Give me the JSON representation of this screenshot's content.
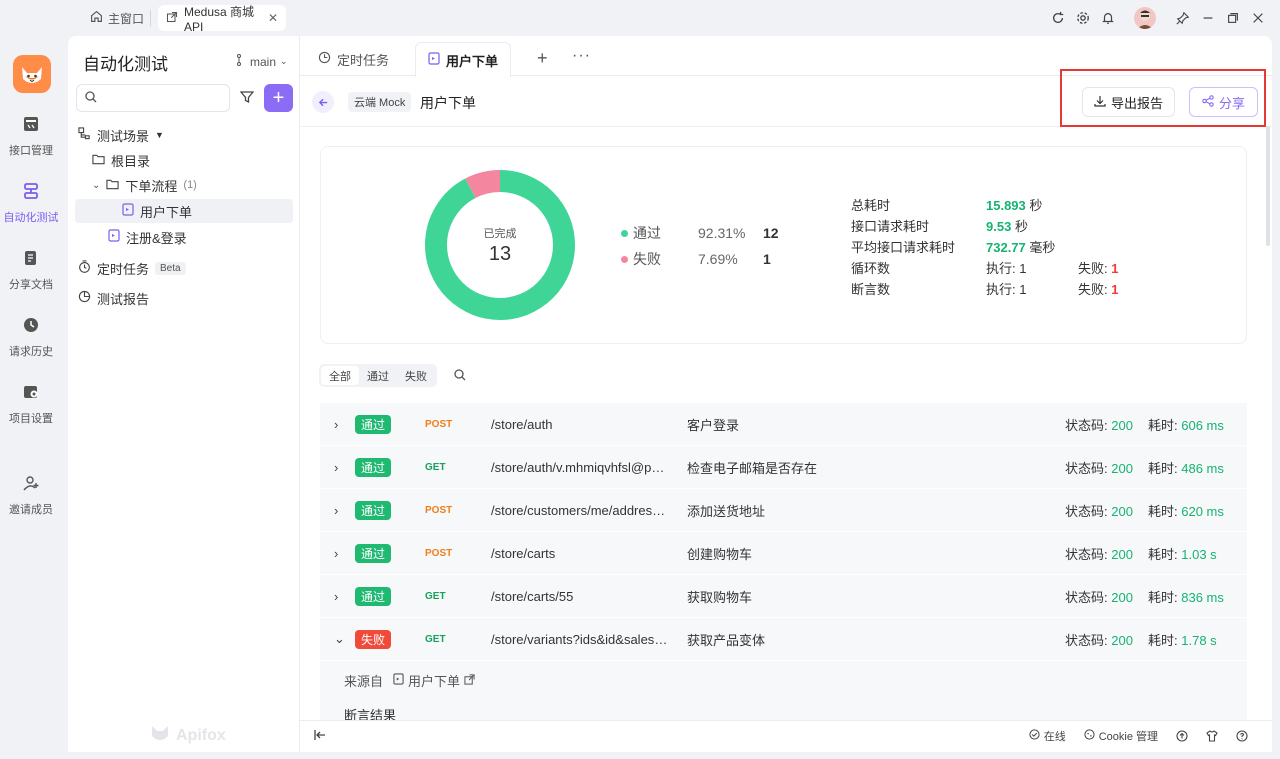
{
  "titlebar": {
    "home_tab": "主窗口",
    "project_tab": "Medusa 商城 API"
  },
  "leftnav": [
    {
      "label": "接口管理",
      "icon": "api-icon"
    },
    {
      "label": "自动化测试",
      "icon": "automation-icon"
    },
    {
      "label": "分享文档",
      "icon": "share-doc-icon"
    },
    {
      "label": "请求历史",
      "icon": "history-icon"
    },
    {
      "label": "项目设置",
      "icon": "settings-icon"
    },
    {
      "label": "邀请成员",
      "icon": "invite-icon"
    }
  ],
  "sidebar": {
    "title": "自动化测试",
    "branch": "main",
    "search_placeholder": "",
    "tree": {
      "scenes_label": "测试场景",
      "root": "根目录",
      "folder": "下单流程",
      "folder_count": "(1)",
      "active_item": "用户下单",
      "item2": "注册&登录",
      "scheduled": "定时任务",
      "beta": "Beta",
      "reports": "测试报告"
    },
    "watermark": "Apifox"
  },
  "tabs": [
    {
      "label": "定时任务"
    },
    {
      "label": "用户下单"
    }
  ],
  "header": {
    "mock_badge": "云端 Mock",
    "title": "用户下单",
    "export_label": "导出报告",
    "share_label": "分享"
  },
  "summary": {
    "center_label": "已完成",
    "total": "13",
    "pass_label": "通过",
    "pass_pct": "92.31%",
    "pass_count": "12",
    "fail_label": "失败",
    "fail_pct": "7.69%",
    "fail_count": "1",
    "pass_color": "#3ed597",
    "fail_color": "#f4879f",
    "pass_fraction": 0.9231,
    "stats": {
      "total_time_label": "总耗时",
      "total_time_value": "15.893",
      "total_time_unit": "秒",
      "req_time_label": "接口请求耗时",
      "req_time_value": "9.53",
      "req_time_unit": "秒",
      "avg_time_label": "平均接口请求耗时",
      "avg_time_value": "732.77",
      "avg_time_unit": "毫秒",
      "loops_label": "循环数",
      "loops_exec": "执行: 1",
      "loops_fail_label": "失败:",
      "loops_fail": "1",
      "asserts_label": "断言数",
      "asserts_exec": "执行: 1",
      "asserts_fail_label": "失败:",
      "asserts_fail": "1"
    }
  },
  "filters": [
    "全部",
    "通过",
    "失败"
  ],
  "results": [
    {
      "status": "通过",
      "ok": true,
      "method": "POST",
      "path": "/store/auth",
      "desc": "客户登录",
      "code_label": "状态码:",
      "code": "200",
      "time_label": "耗时:",
      "time": "606 ms"
    },
    {
      "status": "通过",
      "ok": true,
      "method": "GET",
      "path": "/store/auth/v.mhmiqvhfsl@pbl...",
      "desc": "检查电子邮箱是否存在",
      "code_label": "状态码:",
      "code": "200",
      "time_label": "耗时:",
      "time": "486 ms"
    },
    {
      "status": "通过",
      "ok": true,
      "method": "POST",
      "path": "/store/customers/me/addresses",
      "desc": "添加送货地址",
      "code_label": "状态码:",
      "code": "200",
      "time_label": "耗时:",
      "time": "620 ms"
    },
    {
      "status": "通过",
      "ok": true,
      "method": "POST",
      "path": "/store/carts",
      "desc": "创建购物车",
      "code_label": "状态码:",
      "code": "200",
      "time_label": "耗时:",
      "time": "1.03 s"
    },
    {
      "status": "通过",
      "ok": true,
      "method": "GET",
      "path": "/store/carts/55",
      "desc": "获取购物车",
      "code_label": "状态码:",
      "code": "200",
      "time_label": "耗时:",
      "time": "836 ms"
    },
    {
      "status": "失败",
      "ok": false,
      "method": "GET",
      "path": "/store/variants?ids&id&sales_c...",
      "desc": "获取产品变体",
      "code_label": "状态码:",
      "code": "200",
      "time_label": "耗时:",
      "time": "1.78 s"
    }
  ],
  "detail": {
    "source_label": "来源自",
    "source_link": "用户下单",
    "assert_label": "断言结果"
  },
  "bottombar": {
    "online": "在线",
    "cookie": "Cookie 管理"
  }
}
